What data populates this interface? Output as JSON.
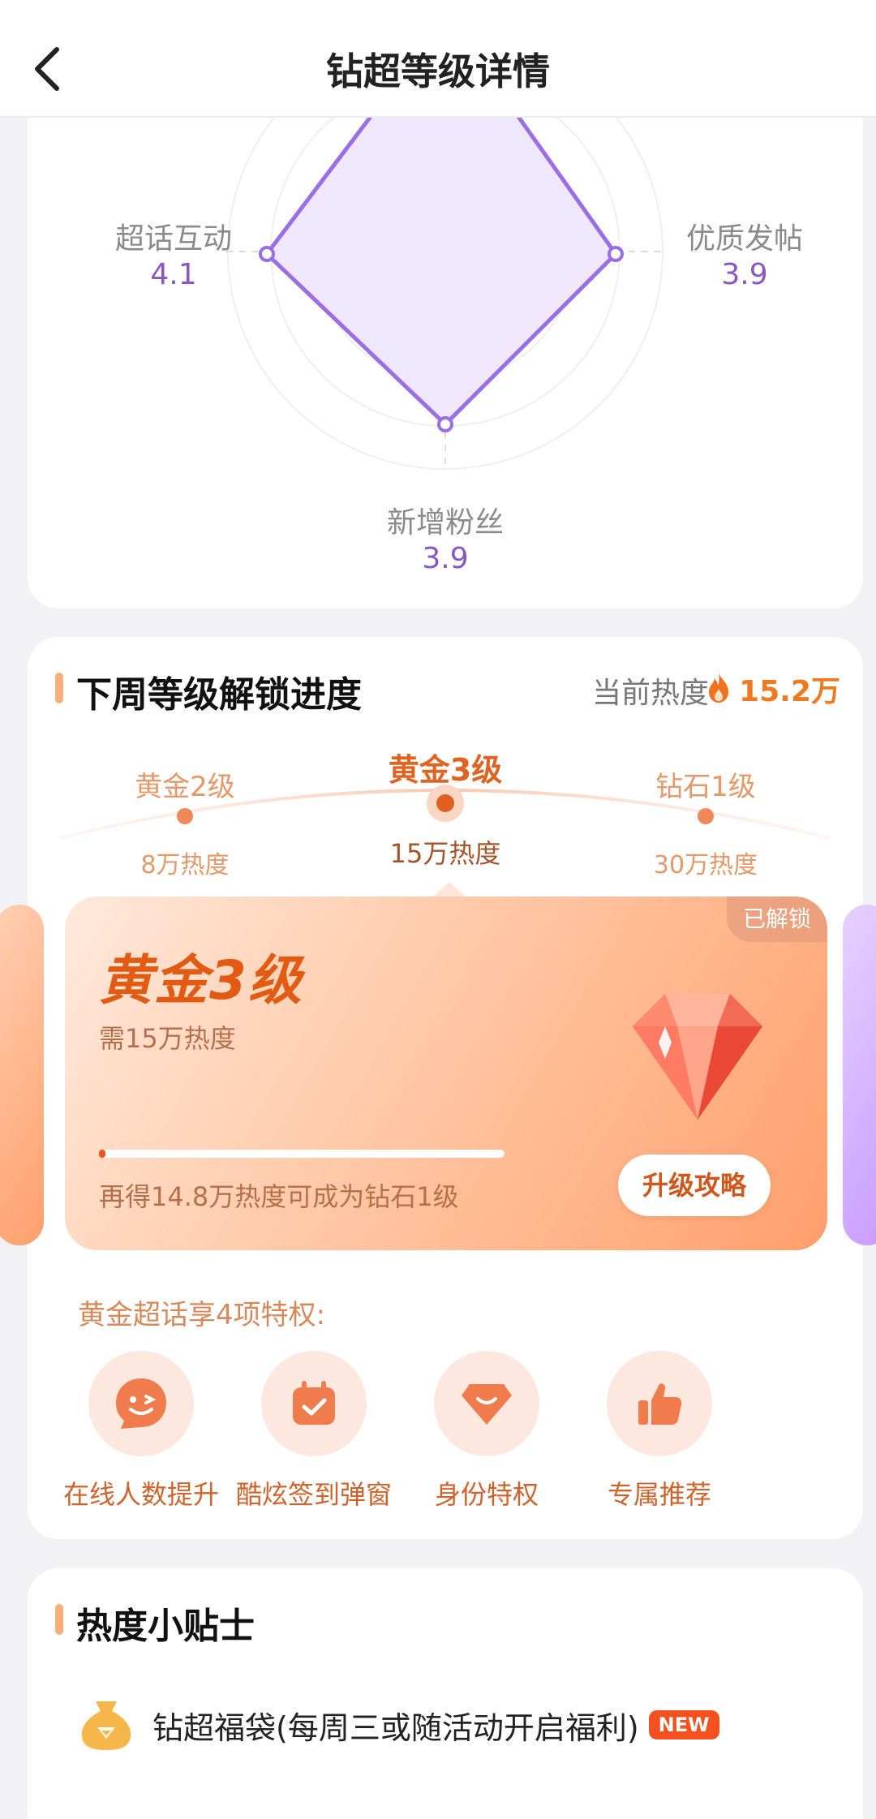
{
  "header": {
    "title": "钻超等级详情"
  },
  "radar": {
    "labels": [
      {
        "name": "超话互动",
        "value": "4.1"
      },
      {
        "name": "优质发帖",
        "value": "3.9"
      },
      {
        "name": "新增粉丝",
        "value": "3.9"
      }
    ],
    "colors": {
      "stroke": "#9a6ee6",
      "fill": "#efe8fd",
      "value": "#8a55c5"
    }
  },
  "progress": {
    "section_title": "下周等级解锁进度",
    "current_heat_label": "当前热度",
    "current_heat_value": "15.2万",
    "levels": [
      {
        "name": "黄金2级",
        "req": "8万热度"
      },
      {
        "name": "黄金3级",
        "req": "15万热度"
      },
      {
        "name": "钻石1级",
        "req": "30万热度"
      }
    ],
    "card": {
      "badge": "已解锁",
      "level": "黄金3级",
      "need": "需15万热度",
      "progress_fraction": 0.01,
      "progress_text": "再得14.8万热度可成为钻石1级",
      "button": "升级攻略"
    },
    "privileges_title": "黄金超话享4项特权:",
    "privileges": [
      {
        "label": "在线人数提升",
        "icon": "wink-face-icon"
      },
      {
        "label": "酷炫签到弹窗",
        "icon": "calendar-check-icon"
      },
      {
        "label": "身份特权",
        "icon": "gem-badge-icon"
      },
      {
        "label": "专属推荐",
        "icon": "thumbs-up-icon"
      }
    ]
  },
  "tips": {
    "section_title": "热度小贴士",
    "items": [
      {
        "text": "钻超福袋(每周三或随活动开启福利)",
        "badge": "NEW"
      }
    ]
  }
}
